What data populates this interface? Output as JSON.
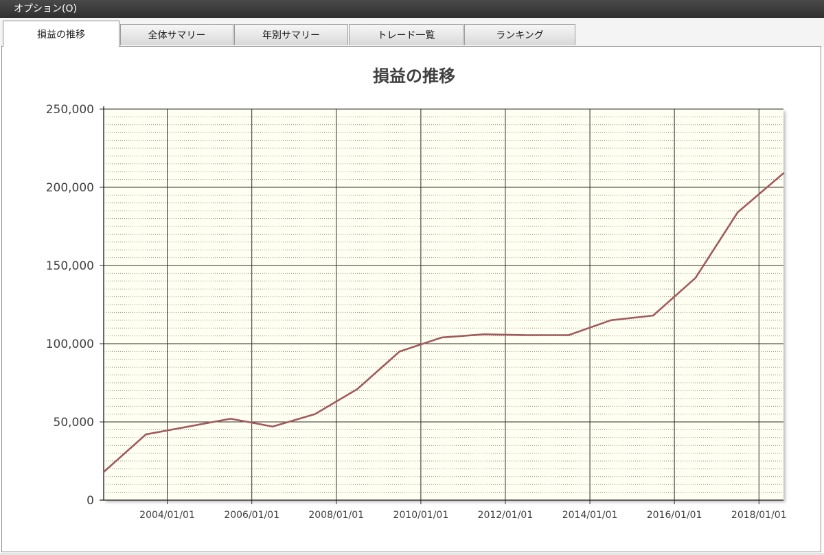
{
  "menu": {
    "options_label": "オプション(O)"
  },
  "tabs": [
    {
      "label": "損益の推移",
      "active": true
    },
    {
      "label": "全体サマリー",
      "active": false
    },
    {
      "label": "年別サマリー",
      "active": false
    },
    {
      "label": "トレード一覧",
      "active": false
    },
    {
      "label": "ランキング",
      "active": false
    }
  ],
  "colors": {
    "plot_background": "#fffff2",
    "line": "#a35a5c",
    "major_grid": "#2b2b2b",
    "minor_grid": "#8f8f8f",
    "text": "#404040"
  },
  "chart_data": {
    "type": "line",
    "title": "損益の推移",
    "xlabel": "",
    "ylabel": "",
    "ylim": [
      0,
      250000
    ],
    "xlim": [
      "2002/07/01",
      "2018/08/01"
    ],
    "y_ticks": [
      0,
      50000,
      100000,
      150000,
      200000,
      250000
    ],
    "y_tick_labels": [
      "0",
      "50,000",
      "100,000",
      "150,000",
      "200,000",
      "250,000"
    ],
    "x_ticks": [
      "2004/01/01",
      "2006/01/01",
      "2008/01/01",
      "2010/01/01",
      "2012/01/01",
      "2014/01/01",
      "2016/01/01",
      "2018/01/01"
    ],
    "x_tick_labels": [
      "2004/01/01",
      "2006/01/01",
      "2008/01/01",
      "2010/01/01",
      "2012/01/01",
      "2014/01/01",
      "2016/01/01",
      "2018/01/01"
    ],
    "grid": {
      "major": true,
      "minor_y": true,
      "minor_y_step": 5000
    },
    "legend": "none",
    "series": [
      {
        "x": [
          "2002/07/01",
          "2003/07/01",
          "2004/07/01",
          "2005/07/01",
          "2006/07/01",
          "2007/07/01",
          "2008/07/01",
          "2009/07/01",
          "2010/07/01",
          "2011/07/01",
          "2012/07/01",
          "2013/07/01",
          "2014/07/01",
          "2015/07/01",
          "2016/07/01",
          "2017/07/01",
          "2018/08/01"
        ],
        "values": [
          18000,
          42000,
          47000,
          52000,
          47000,
          55000,
          71000,
          95000,
          104000,
          106000,
          105500,
          105500,
          115000,
          118000,
          142000,
          184000,
          209000
        ]
      }
    ]
  }
}
